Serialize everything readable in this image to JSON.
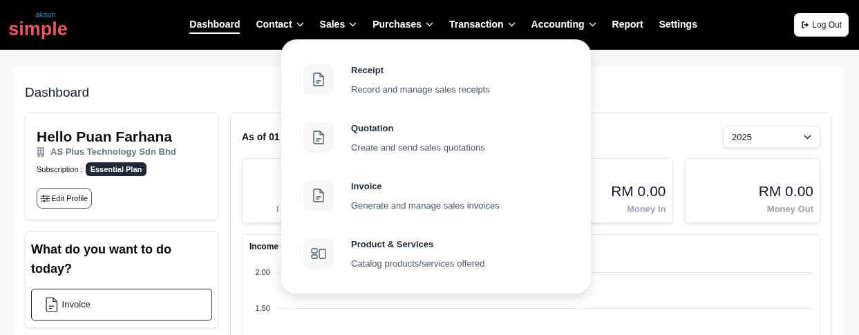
{
  "logo": {
    "top": "akaun",
    "main": "simple"
  },
  "nav": [
    {
      "label": "Dashboard",
      "selected": true,
      "dropdown": false
    },
    {
      "label": "Contact",
      "selected": false,
      "dropdown": true
    },
    {
      "label": "Sales",
      "selected": false,
      "dropdown": true
    },
    {
      "label": "Purchases",
      "selected": false,
      "dropdown": true
    },
    {
      "label": "Transaction",
      "selected": false,
      "dropdown": true
    },
    {
      "label": "Accounting",
      "selected": false,
      "dropdown": true
    },
    {
      "label": "Report",
      "selected": false,
      "dropdown": false
    },
    {
      "label": "Settings",
      "selected": false,
      "dropdown": false
    }
  ],
  "logout": "Log Out",
  "page_title": "Dashboard",
  "profile": {
    "greeting": "Hello Puan Farhana",
    "company": "AS Plus Technology Sdn Bhd",
    "subscription_label": "Subscription :",
    "plan": "Essential Plan",
    "edit_button": "Edit Profile"
  },
  "actions": {
    "title": "What do you want to do today?",
    "items": [
      "Invoice"
    ]
  },
  "summary": {
    "as_of": "As of 01",
    "year": "2025",
    "cards": [
      {
        "label": "I"
      },
      {
        "value": "RM 0.00",
        "label": "Money In"
      },
      {
        "value": "RM 0.00",
        "label": "Money Out"
      }
    ]
  },
  "chart": {
    "title": "Income",
    "y_ticks": [
      "2.00",
      "1.50"
    ]
  },
  "sales_menu": [
    {
      "kind": "doc",
      "title": "Receipt",
      "description": "Record and manage sales receipts"
    },
    {
      "kind": "doc",
      "title": "Quotation",
      "description": "Create and send sales quotations"
    },
    {
      "kind": "doc",
      "title": "Invoice",
      "description": "Generate and manage sales invoices"
    },
    {
      "kind": "catalog",
      "title": "Product & Services",
      "description": "Catalog products/services offered"
    }
  ]
}
